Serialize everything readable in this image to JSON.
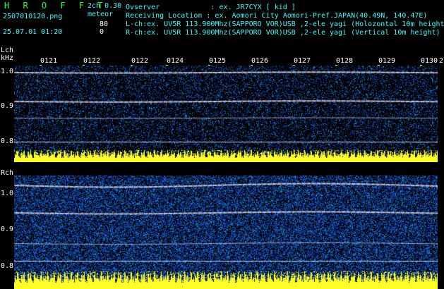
{
  "header": {
    "title": "H R O F F T",
    "filename": "2507010120.png",
    "datetime": "25.07.01 01:20",
    "channel_info": "2ch 0.30",
    "meteor_label": "meteor",
    "meteor_lch": "80",
    "meteor_rch": "0",
    "observer": "Ovserver            : ex. JR7CYX [ kid ]",
    "location": "Receiving Location : ex. Aomori City Aomori-Pref.JAPAN(40.49N, 140.47E)",
    "lch_info": "L-ch:ex. UV5R 113.900Mhz(SAPPORO VOR)USB ,2-ele yagi (Holozontal 10m height)",
    "rch_info": "R-ch:ex. UV5R 113.900Mhz(SAPPORO VOR)USB ,2-ele yagi (Vertical 10m height)"
  },
  "time_axis": {
    "ticks": [
      "0121",
      "0122",
      "0122",
      "0124",
      "0125",
      "0126",
      "0127",
      "0128",
      "0129",
      "0130"
    ],
    "edge_label": "2"
  },
  "lch": {
    "label": "Lch",
    "unit": "kHz",
    "y_ticks": [
      "1.0",
      "0.9",
      "0.8"
    ]
  },
  "rch": {
    "label": "Rch",
    "y_ticks": [
      "1.0",
      "0.9",
      "0.8"
    ]
  },
  "colors": {
    "background": "#000000",
    "header_green": "#22ff22",
    "header_cyan": "#33ffff",
    "signal_yellow": "#ffff33",
    "noise_blue": "#0a2a9a"
  }
}
